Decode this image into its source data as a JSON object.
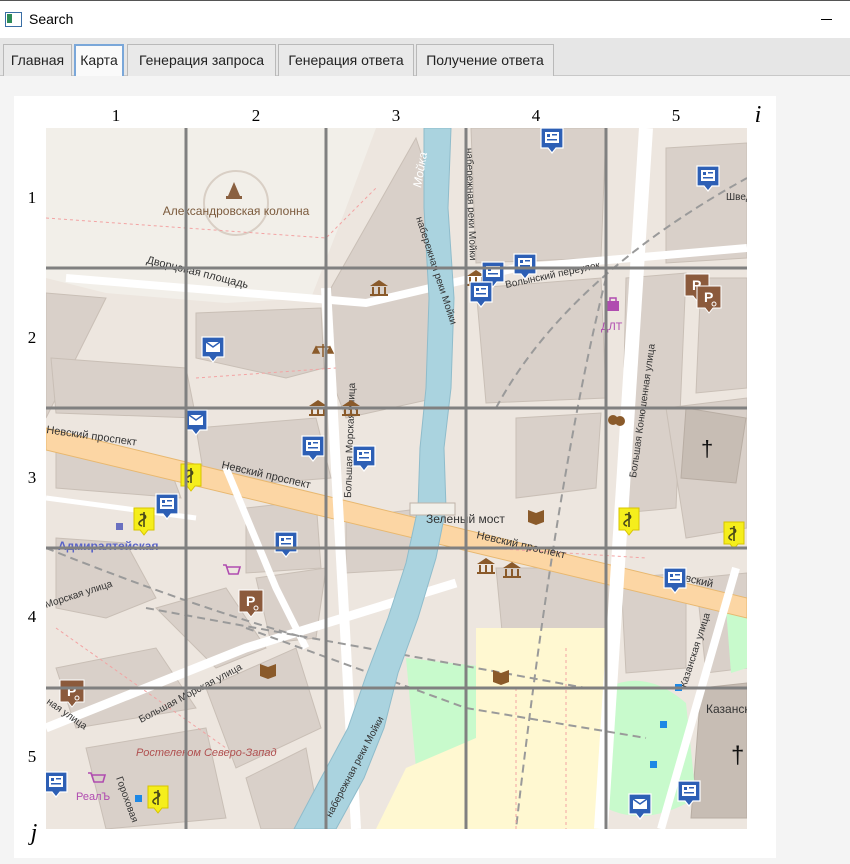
{
  "window": {
    "title": "Search",
    "icon": "app-window-icon"
  },
  "tabs": [
    {
      "label": "Главная",
      "active": false
    },
    {
      "label": "Карта",
      "active": true
    },
    {
      "label": "Генерация запроса",
      "active": false
    },
    {
      "label": "Генерация ответа",
      "active": false
    },
    {
      "label": "Получение ответа",
      "active": false
    }
  ],
  "grid": {
    "columns": [
      "1",
      "2",
      "3",
      "4",
      "5"
    ],
    "rows": [
      "1",
      "2",
      "3",
      "4",
      "5"
    ],
    "x_axis_label": "i",
    "y_axis_label": "j"
  },
  "map": {
    "labels": {
      "column_name": "Александровская колонна",
      "square": "Дворцовая площадь",
      "moika_1": "Мойка",
      "moika_2": "набережная реки Мойки",
      "moika_3": "набережная реки Мойки",
      "moika_4": "набережная реки Мойки",
      "nevsky_1": "Невский проспект",
      "nevsky_2": "Невский проспект",
      "nevsky_3": "Невский проспект",
      "nevsky_4": "Невский",
      "bridge": "Зеленый мост",
      "bolshaya_morskaya_1": "Большая Морская улица",
      "bolshaya_morskaya_2": "Большая Морская улица",
      "admiralteyskaya": "Адмиралтейская",
      "morskaya": "Морская улица",
      "konyushennaya": "Большая Конюшенная улица",
      "kazanskaya": "Казанская улица",
      "kazan_square": "Казанская площ",
      "lane": "Волынский переулок",
      "dlt": "ДЛТ",
      "shved": "Швед",
      "rostelecom": "Ростелеком Северо-Запад",
      "real": "РеалЪ",
      "gorokhovaya": "Гороховая",
      "yaya": "ная улица"
    },
    "colors": {
      "land": "#ede6df",
      "block": "#d9d0c9",
      "water": "#aad3df",
      "park": "#c8facc",
      "plaza": "#f2efe9",
      "road": "#ffffff",
      "major_road": "#fcd6a4",
      "bank_marker": "#2d5fb5",
      "pharmacy_marker": "#f5ee1c",
      "parking_marker": "#8b5a3c",
      "grid_line": "#808080"
    }
  }
}
